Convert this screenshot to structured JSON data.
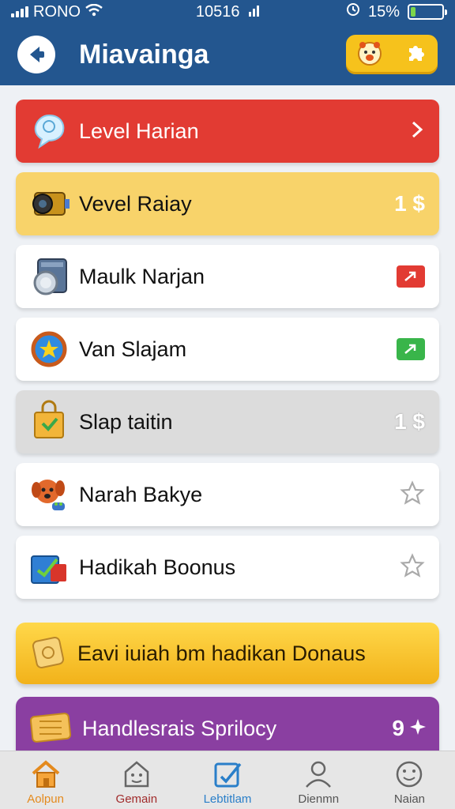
{
  "status": {
    "carrier": "RONO",
    "time": "10516",
    "battery": "15%",
    "battery_level": 0.15
  },
  "header": {
    "title": "Miavainga"
  },
  "items": [
    {
      "label": "Level Harian",
      "style": "red",
      "trail": ""
    },
    {
      "label": "Vevel Raiay",
      "style": "yellow",
      "trail": "1 $"
    },
    {
      "label": "Maulk Narjan",
      "style": "white",
      "trail": ""
    },
    {
      "label": "Van Slajam",
      "style": "white",
      "trail": ""
    },
    {
      "label": "Slap taitin",
      "style": "grey",
      "trail": "1 $"
    },
    {
      "label": "Narah Bakye",
      "style": "white",
      "trail": ""
    },
    {
      "label": "Hadikah Boonus",
      "style": "white",
      "trail": ""
    }
  ],
  "banners": {
    "gold": {
      "label": "Eavi iuiah bm hadikan Donaus"
    },
    "purple": {
      "label": "Handlesrais Sprilocy",
      "trail": "9"
    }
  },
  "tabs": [
    {
      "label": "Aolpun",
      "color": "#e48a1d"
    },
    {
      "label": "Gemain",
      "color": "#a12c2c"
    },
    {
      "label": "Lebtitlam",
      "color": "#2a7fc9"
    },
    {
      "label": "Dienmn",
      "color": "#555555"
    },
    {
      "label": "Naian",
      "color": "#555555"
    }
  ],
  "colors": {
    "header": "#23568f",
    "red": "#e23b33",
    "yellow": "#f8d36a",
    "gold": "#f6c21c",
    "purple": "#8a3fa1"
  }
}
